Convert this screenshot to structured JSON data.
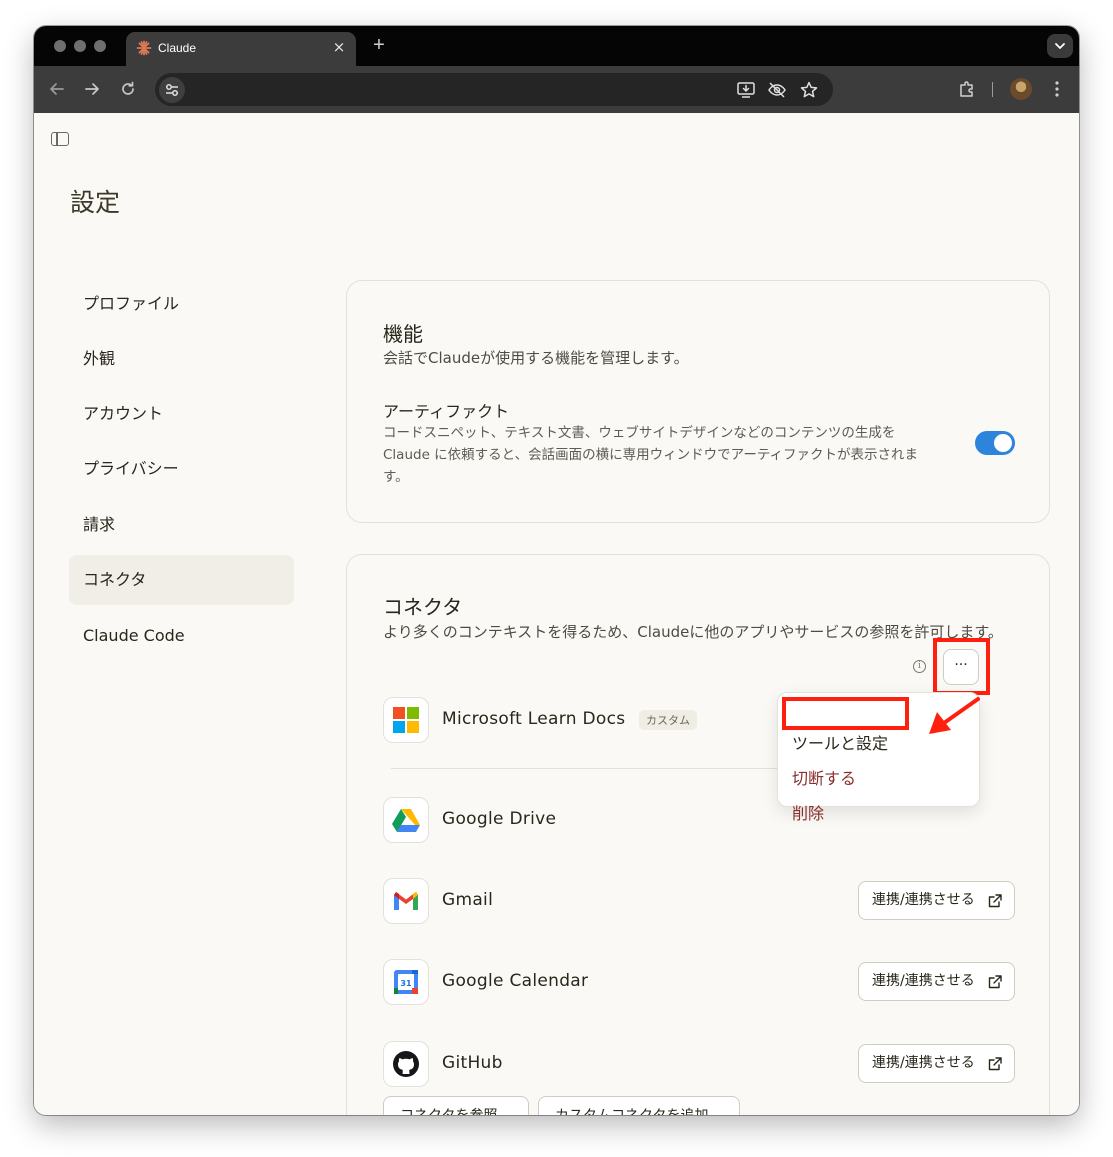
{
  "browser": {
    "tab_title": "Claude",
    "tab_close_glyph": "×",
    "new_tab_glyph": "+",
    "icons": [
      "back-icon",
      "forward-icon",
      "reload-icon",
      "site-settings-icon",
      "install-app-icon",
      "eye-off-icon",
      "bookmark-star-icon",
      "extensions-icon",
      "profile-avatar",
      "more-menu-icon"
    ]
  },
  "page": {
    "title": "設定"
  },
  "sidebar": {
    "items": [
      {
        "label": "プロファイル"
      },
      {
        "label": "外観"
      },
      {
        "label": "アカウント"
      },
      {
        "label": "プライバシー"
      },
      {
        "label": "請求"
      },
      {
        "label": "コネクタ",
        "active": true
      },
      {
        "label": "Claude Code"
      }
    ]
  },
  "features": {
    "title": "機能",
    "description": "会話でClaudeが使用する機能を管理します。",
    "artifact": {
      "title": "アーティファクト",
      "description": "コードスニペット、テキスト文書、ウェブサイトデザインなどのコンテンツの生成を Claude に依頼すると、会話画面の横に専用ウィンドウでアーティファクトが表示されます。",
      "enabled": true
    }
  },
  "connectors": {
    "title": "コネクタ",
    "description": "より多くのコンテキストを得るため、Claudeに他のアプリやサービスの参照を許可します。",
    "items": [
      {
        "name": "Microsoft Learn Docs",
        "badge": "カスタム",
        "icon": "microsoft-logo-icon"
      },
      {
        "name": "Google Drive",
        "icon": "google-drive-icon"
      },
      {
        "name": "Gmail",
        "action": "連携/連携させる",
        "icon": "gmail-icon"
      },
      {
        "name": "Google Calendar",
        "action": "連携/連携させる",
        "icon": "google-calendar-icon"
      },
      {
        "name": "GitHub",
        "action": "連携/連携させる",
        "icon": "github-icon"
      }
    ],
    "more_glyph": "···",
    "menu": [
      {
        "label": "ツールと設定"
      },
      {
        "label": "切断する"
      },
      {
        "label": "削除"
      }
    ],
    "calendar_day": "31",
    "bottom_buttons": [
      {
        "label": "コネクタを参照"
      },
      {
        "label": "カスタムコネクタを追加"
      }
    ]
  },
  "colors": {
    "toggle_on": "#2c84db",
    "highlight": "#ff1f0f",
    "danger_text": "#8a2e2e"
  }
}
